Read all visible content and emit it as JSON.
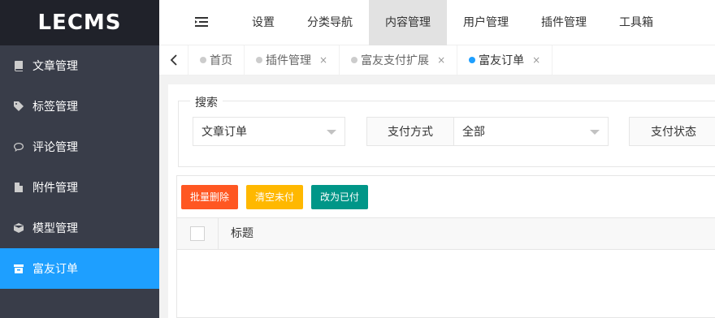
{
  "logo": "LECMS",
  "sidebar": {
    "items": [
      {
        "label": "文章管理",
        "icon": "book-icon"
      },
      {
        "label": "标签管理",
        "icon": "tag-icon"
      },
      {
        "label": "评论管理",
        "icon": "comment-icon"
      },
      {
        "label": "附件管理",
        "icon": "file-icon"
      },
      {
        "label": "模型管理",
        "icon": "cube-icon"
      },
      {
        "label": "富友订单",
        "icon": "archive-icon",
        "active": true
      }
    ]
  },
  "topnav": {
    "items": [
      "设置",
      "分类导航",
      "内容管理",
      "用户管理",
      "插件管理",
      "工具箱"
    ],
    "active_index": 2
  },
  "tabs": [
    {
      "label": "首页",
      "closable": false
    },
    {
      "label": "插件管理",
      "closable": true
    },
    {
      "label": "富友支付扩展",
      "closable": true
    },
    {
      "label": "富友订单",
      "closable": true,
      "active": true
    }
  ],
  "tab_close_glyph": "×",
  "search": {
    "legend": "搜索",
    "type_value": "文章订单",
    "pay_method_label": "支付方式",
    "pay_method_value": "全部",
    "pay_status_label": "支付状态"
  },
  "toolbar": {
    "batch_delete": "批量删除",
    "clear_unpaid": "清空未付",
    "mark_paid": "改为已付"
  },
  "table": {
    "columns": [
      "标题"
    ]
  },
  "colors": {
    "accent": "#1e9fff",
    "sidebar_bg": "#393d49",
    "logo_bg": "#20222a",
    "btn_danger": "#ff5722",
    "btn_warn": "#ffb800",
    "btn_ok": "#009688"
  }
}
